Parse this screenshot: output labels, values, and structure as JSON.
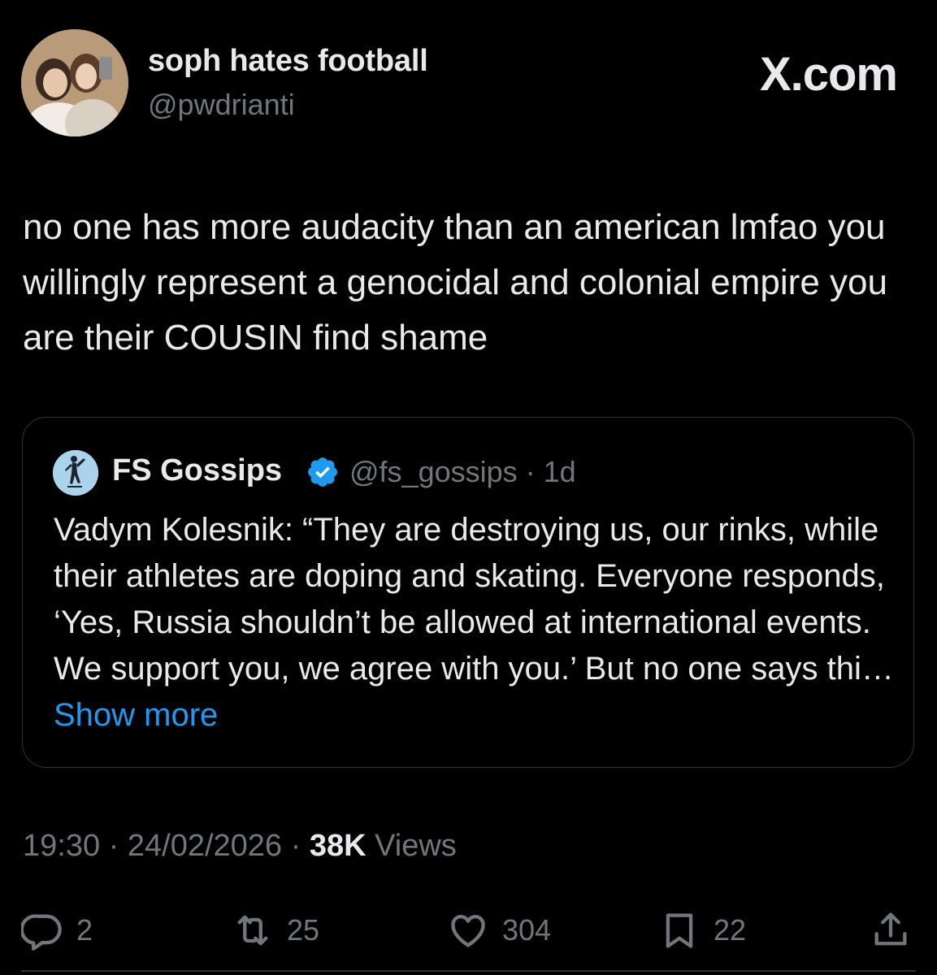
{
  "author": {
    "display_name": "soph hates football",
    "handle": "@pwdrianti"
  },
  "brand": "X.com",
  "tweet_text": "no one has more audacity than an american lmfao you willingly represent a genocidal and colonial empire you are their COUSIN find shame",
  "quoted": {
    "display_name": "FS Gossips",
    "handle_time": "@fs_gossips · 1d",
    "text": "Vadym Kolesnik: “They are destroying us, our rinks, while their athletes are doping and skating. Everyone responds, ‘Yes, Russia shouldn’t be allowed at international events. We support you, we agree with you.’ But no one says thi…",
    "show_more": "Show more"
  },
  "meta": {
    "timestamp": "19:30 · 24/02/2026 · ",
    "views_count": "38K",
    "views_label": " Views"
  },
  "actions": {
    "replies": "2",
    "reposts": "25",
    "likes": "304",
    "bookmarks": "22"
  },
  "icons": {
    "reply": "reply-icon",
    "repost": "repost-icon",
    "like": "heart-icon",
    "bookmark": "bookmark-icon",
    "share": "share-icon",
    "verified": "verified-badge-icon"
  },
  "colors": {
    "background": "#000000",
    "text": "#e7e9ea",
    "secondary": "#71767b",
    "accent": "#1d9bf0",
    "border": "#2f3336"
  }
}
